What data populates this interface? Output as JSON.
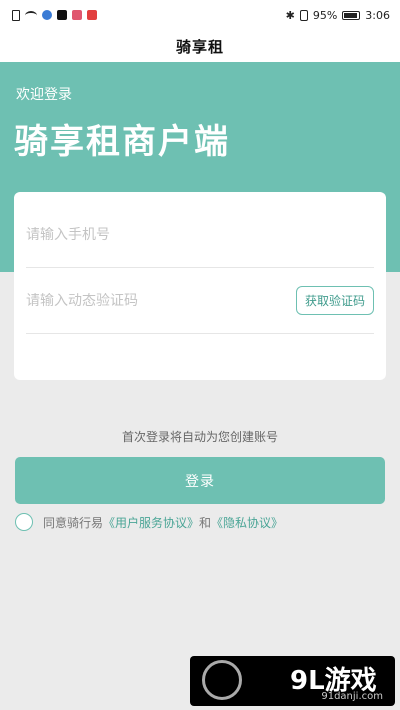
{
  "status_bar": {
    "battery": "95%",
    "time": "3:06"
  },
  "nav": {
    "title": "骑享租"
  },
  "hero": {
    "welcome": "欢迎登录",
    "title": "骑享租商户端"
  },
  "form": {
    "phone_placeholder": "请输入手机号",
    "code_placeholder": "请输入动态验证码",
    "get_code_label": "获取验证码"
  },
  "hint": "首次登录将自动为您创建账号",
  "login_label": "登录",
  "agreement": {
    "prefix": "同意骑行易",
    "user_agreement": "《用户服务协议》",
    "and": "和",
    "privacy": "《隐私协议》"
  },
  "watermark": {
    "main": "9L游戏",
    "sub": "91danji.com"
  },
  "colors": {
    "accent": "#6ec0b2",
    "background": "#ebebeb"
  }
}
